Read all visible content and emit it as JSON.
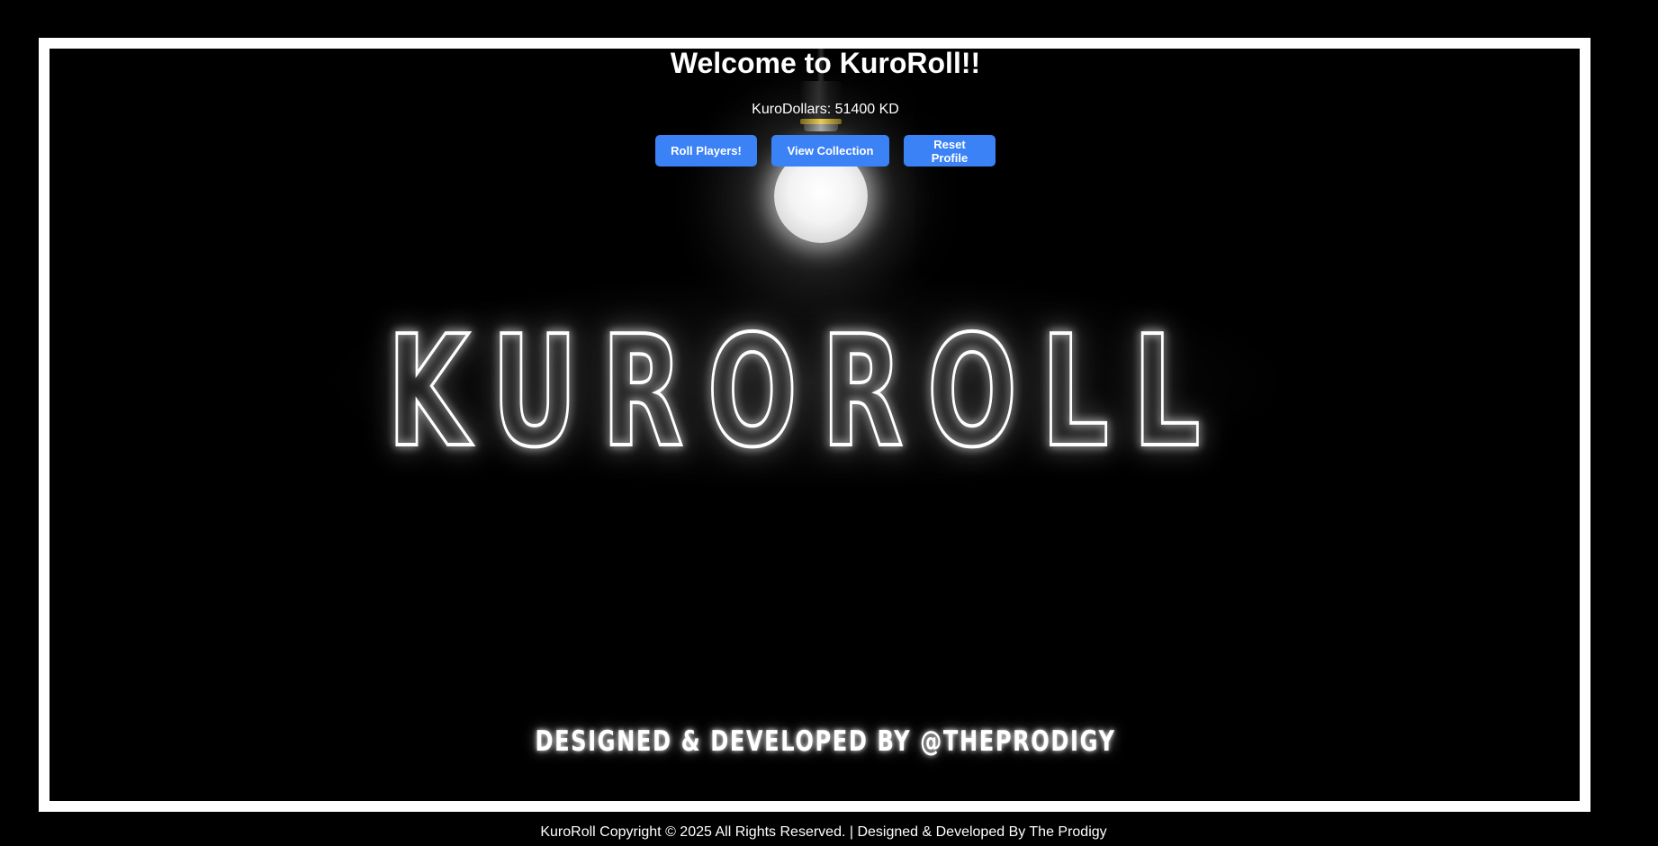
{
  "header": {
    "title": "Welcome to KuroRoll!!",
    "currency_text": "KuroDollars: 51400 KD"
  },
  "actions": {
    "roll_label": "Roll Players!",
    "view_label": "View Collection",
    "reset_label": "Reset Profile"
  },
  "hero": {
    "neon_title": "KUROROLL",
    "credit": "DESIGNED & DEVELOPED BY @THEPRODIGY"
  },
  "footer": {
    "text": "KuroRoll Copyright © 2025 All Rights Reserved. | Designed & Developed By The Prodigy"
  },
  "colors": {
    "background": "#000000",
    "frame": "#ffffff",
    "button": "#3b82f6",
    "neon": "#ffffff"
  }
}
